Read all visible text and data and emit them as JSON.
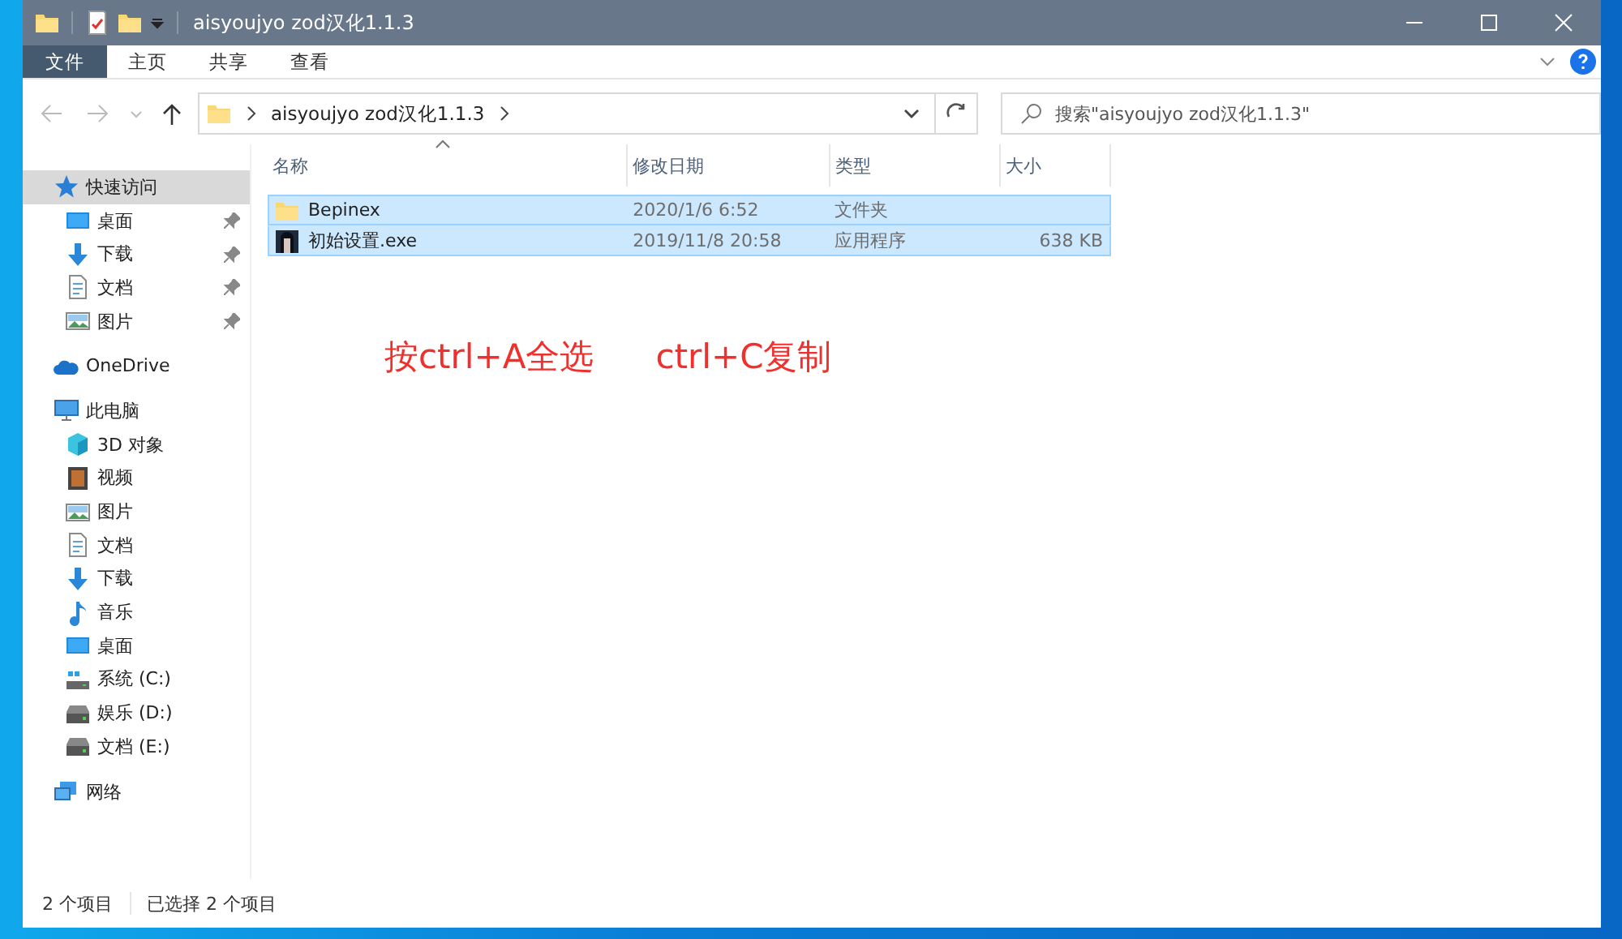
{
  "window": {
    "title": "aisyoujyo zod汉化1.1.3"
  },
  "ribbon_tabs": [
    {
      "label": "文件",
      "kind": "file",
      "selected": false
    },
    {
      "label": "主页",
      "kind": "tab",
      "selected": false
    },
    {
      "label": "共享",
      "kind": "tab",
      "selected": false
    },
    {
      "label": "查看",
      "kind": "tab",
      "selected": false
    }
  ],
  "address": {
    "path": [
      "aisyoujyo zod汉化1.1.3"
    ]
  },
  "search": {
    "placeholder": "搜索\"aisyoujyo zod汉化1.1.3\""
  },
  "sidebar": {
    "items": [
      {
        "label": "快速访问",
        "kind": "star",
        "selected": true,
        "children": [
          {
            "label": "桌面",
            "kind": "desktop",
            "pinned": true,
            "selected": false
          },
          {
            "label": "下载",
            "kind": "download",
            "pinned": true,
            "selected": false
          },
          {
            "label": "文档",
            "kind": "document",
            "pinned": true,
            "selected": false
          },
          {
            "label": "图片",
            "kind": "picture",
            "pinned": true,
            "selected": false
          }
        ]
      },
      {
        "label": "OneDrive",
        "kind": "cloud",
        "selected": false
      },
      {
        "label": "此电脑",
        "kind": "pc",
        "selected": false,
        "children": [
          {
            "label": "3D 对象",
            "kind": "cube",
            "selected": false
          },
          {
            "label": "视频",
            "kind": "video",
            "selected": false
          },
          {
            "label": "图片",
            "kind": "picture",
            "selected": false
          },
          {
            "label": "文档",
            "kind": "document",
            "selected": false
          },
          {
            "label": "下载",
            "kind": "download",
            "selected": false
          },
          {
            "label": "音乐",
            "kind": "music",
            "selected": false
          },
          {
            "label": "桌面",
            "kind": "desktop",
            "selected": false
          },
          {
            "label": "系统 (C:)",
            "kind": "sysdrive",
            "selected": false
          },
          {
            "label": "娱乐 (D:)",
            "kind": "drive",
            "selected": false
          },
          {
            "label": "文档 (E:)",
            "kind": "drive",
            "selected": false
          }
        ]
      },
      {
        "label": "网络",
        "kind": "network",
        "selected": false
      }
    ]
  },
  "table": {
    "columns": [
      {
        "label": "名称",
        "sorted": true
      },
      {
        "label": "修改日期",
        "sorted": false
      },
      {
        "label": "类型",
        "sorted": false
      },
      {
        "label": "大小",
        "sorted": false
      }
    ],
    "rows": [
      {
        "kind": "folder",
        "name": "Bepinex",
        "date": "2020/1/6 6:52",
        "type": "文件夹",
        "selected": true
      },
      {
        "kind": "app",
        "name": "初始设置.exe",
        "date": "2019/11/8 20:58",
        "type": "应用程序",
        "size": "638 KB",
        "selected": true
      }
    ]
  },
  "annotations": [
    "按ctrl+A全选",
    "ctrl+C复制"
  ],
  "status_bar": [
    "2 个项目",
    "已选择 2 个项目"
  ]
}
